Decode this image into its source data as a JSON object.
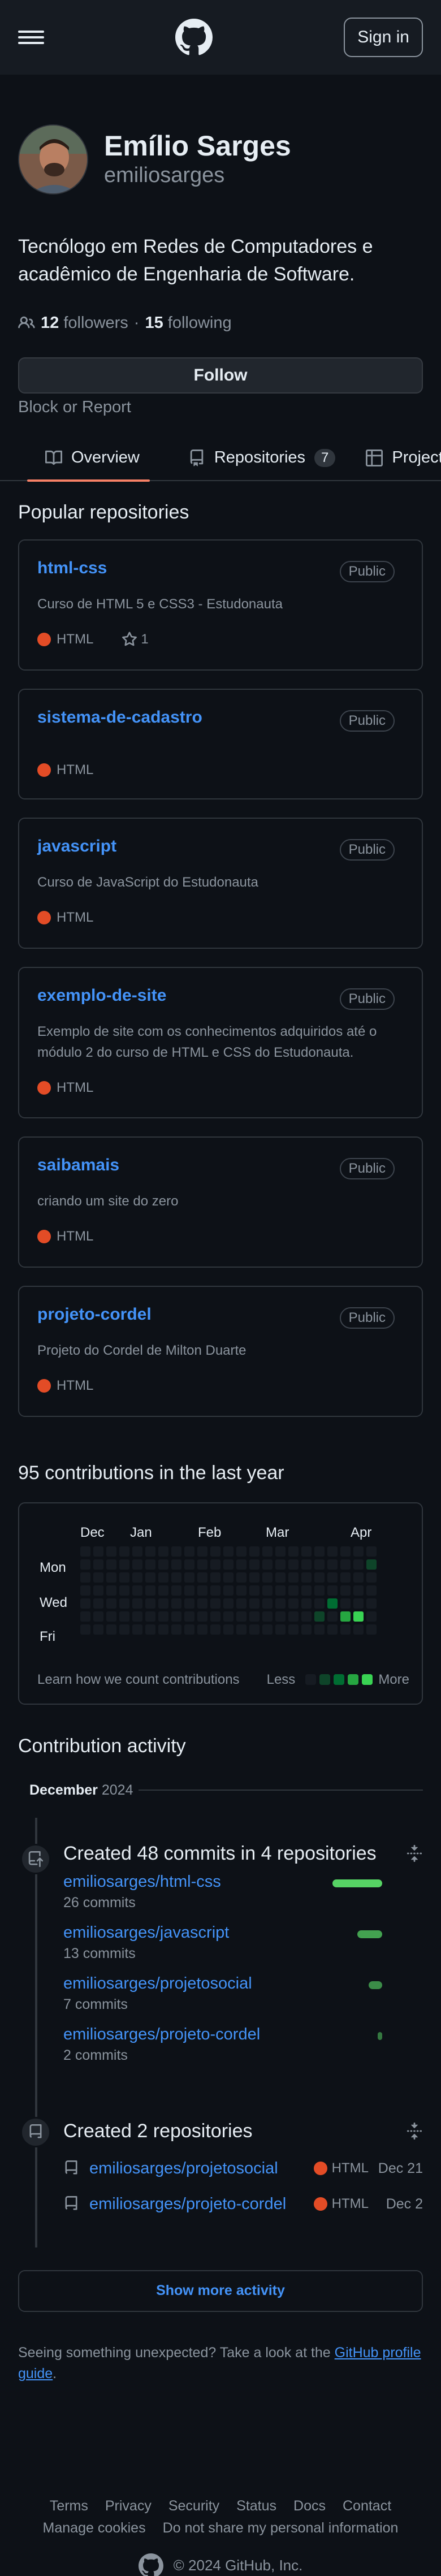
{
  "header": {
    "menu_icon": "hamburger-icon",
    "logo_icon": "github-logo-icon",
    "signin_label": "Sign in"
  },
  "profile": {
    "full_name": "Emílio Sarges",
    "login": "emiliosarges",
    "bio": "Tecnólogo em Redes de Computadores e acadêmico de Engenharia de Software.",
    "followers_count": "12",
    "followers_label": "followers",
    "separator": "·",
    "following_count": "15",
    "following_label": "following",
    "follow_label": "Follow",
    "block_label": "Block or Report"
  },
  "tabs": [
    {
      "label": "Overview",
      "icon": "book-icon",
      "active": true
    },
    {
      "label": "Repositories",
      "icon": "repo-icon",
      "count": "7"
    },
    {
      "label": "Projects",
      "icon": "table-icon"
    }
  ],
  "popular": {
    "title": "Popular repositories",
    "repos": [
      {
        "name": "html-css",
        "visibility": "Public",
        "description": "Curso de HTML 5 e CSS3 - Estudonauta",
        "language": "HTML",
        "stars": "1"
      },
      {
        "name": "sistema-de-cadastro",
        "visibility": "Public",
        "description": "",
        "language": "HTML"
      },
      {
        "name": "javascript",
        "visibility": "Public",
        "description": "Curso de JavaScript do Estudonauta",
        "language": "HTML"
      },
      {
        "name": "exemplo-de-site",
        "visibility": "Public",
        "description": "Exemplo de site com os conhecimentos adquiridos até o módulo 2 do curso de HTML e CSS do Estudonauta.",
        "language": "HTML"
      },
      {
        "name": "saibamais",
        "visibility": "Public",
        "description": "criando um site do zero",
        "language": "HTML"
      },
      {
        "name": "projeto-cordel",
        "visibility": "Public",
        "description": "Projeto do Cordel de Milton Duarte",
        "language": "HTML"
      }
    ]
  },
  "contributions": {
    "title": "95 contributions in the last year",
    "months": [
      "Dec",
      "Jan",
      "Feb",
      "Mar",
      "Apr"
    ],
    "days": [
      "Mon",
      "Wed",
      "Fri"
    ],
    "learn_label": "Learn how we count contributions",
    "less_label": "Less",
    "more_label": "More"
  },
  "activity": {
    "title": "Contribution activity",
    "month": "December",
    "year": "2024",
    "commits_title": "Created 48 commits in 4 repositories",
    "commits": [
      {
        "repo": "emiliosarges/html-css",
        "count": "26 commits",
        "value": 26
      },
      {
        "repo": "emiliosarges/javascript",
        "count": "13 commits",
        "value": 13
      },
      {
        "repo": "emiliosarges/projetosocial",
        "count": "7 commits",
        "value": 7
      },
      {
        "repo": "emiliosarges/projeto-cordel",
        "count": "2 commits",
        "value": 2
      }
    ],
    "repos_title": "Created 2 repositories",
    "created": [
      {
        "repo": "emiliosarges/projetosocial",
        "language": "HTML",
        "date": "Dec 21"
      },
      {
        "repo": "emiliosarges/projeto-cordel",
        "language": "HTML",
        "date": "Dec 2"
      }
    ],
    "show_more_label": "Show more activity",
    "unexpected_text": "Seeing something unexpected? Take a look at the ",
    "guide_link": "GitHub profile guide",
    "unexpected_end": "."
  },
  "footer": {
    "links": [
      "Terms",
      "Privacy",
      "Security",
      "Status",
      "Docs",
      "Contact",
      "Manage cookies",
      "Do not share my personal information"
    ],
    "copyright": "© 2024 GitHub, Inc."
  },
  "colors": {
    "accent": "#4493f8",
    "html_lang": "#e34c26",
    "tab_underline": "#f78166",
    "bar": "#56d364"
  }
}
